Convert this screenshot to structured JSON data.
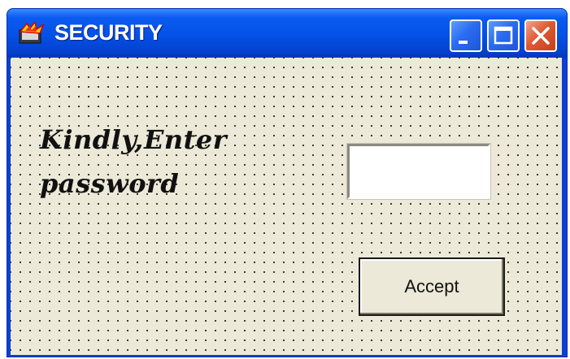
{
  "window": {
    "title": "SECURITY",
    "app_icon": "vb-app-icon",
    "controls": {
      "minimize_icon": "minimize-icon",
      "maximize_icon": "maximize-icon",
      "close_icon": "close-icon"
    }
  },
  "form": {
    "prompt_label": "Kindly,Enter\npassword",
    "password_value": "",
    "password_placeholder": "",
    "accept_label": "Accept"
  },
  "colors": {
    "titlebar_blue": "#0550e6",
    "client_background": "#ece9d8",
    "close_button": "#e05a35",
    "text": "#111111"
  }
}
